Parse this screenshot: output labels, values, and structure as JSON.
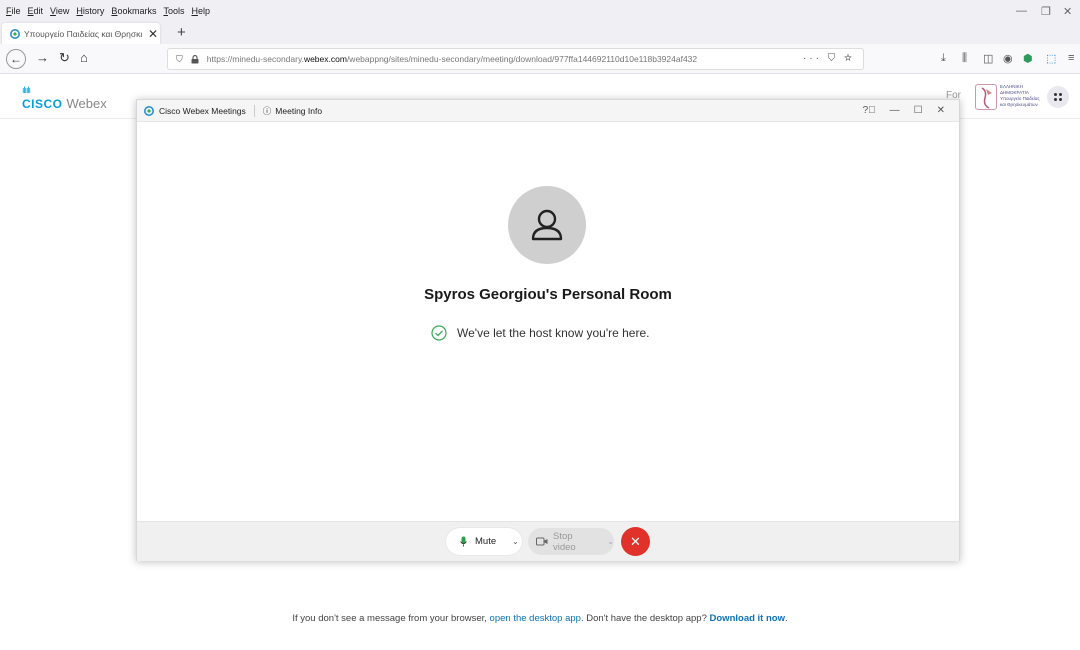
{
  "browser": {
    "menu": [
      "File",
      "Edit",
      "View",
      "History",
      "Bookmarks",
      "Tools",
      "Help"
    ],
    "tab_title": "Υπουργείο Παιδείας και Θρησκευμάτων",
    "url_plain_prefix": "https://minedu-secondary.",
    "url_bold": "webex.com",
    "url_plain_suffix": "/webappng/sites/minedu-secondary/meeting/download/977ffa144692110d10e118b3924af432",
    "url_actions": "··· ⛉ ☆"
  },
  "header": {
    "cisco_dots": "ılıılı",
    "cisco": "CISCO",
    "webex": "Webex",
    "for_text": "For",
    "org_line1": "ΕΛΛΗΝΙΚΗ ΔΗΜΟΚΡΑΤΙΑ",
    "org_line2": "Υπουργείο Παιδείας",
    "org_line3": "και Θρησκευμάτων"
  },
  "meeting_window": {
    "app_name": "Cisco Webex Meetings",
    "meeting_info": "Meeting Info",
    "room_title": "Spyros Georgiou's Personal Room",
    "status": "We've let the host know you're here.",
    "mute_label": "Mute",
    "video_label": "Stop video"
  },
  "bottom": {
    "prefix": "If you don't see a message from your browser, ",
    "open_link": "open the desktop app",
    "middle": ". Don't have the desktop app? ",
    "download_link": "Download it now",
    "suffix": "."
  },
  "colors": {
    "cisco_blue": "#049fd9",
    "leave_red": "#e0312b",
    "link_blue": "#0b74b5",
    "status_green": "#3aa856"
  }
}
